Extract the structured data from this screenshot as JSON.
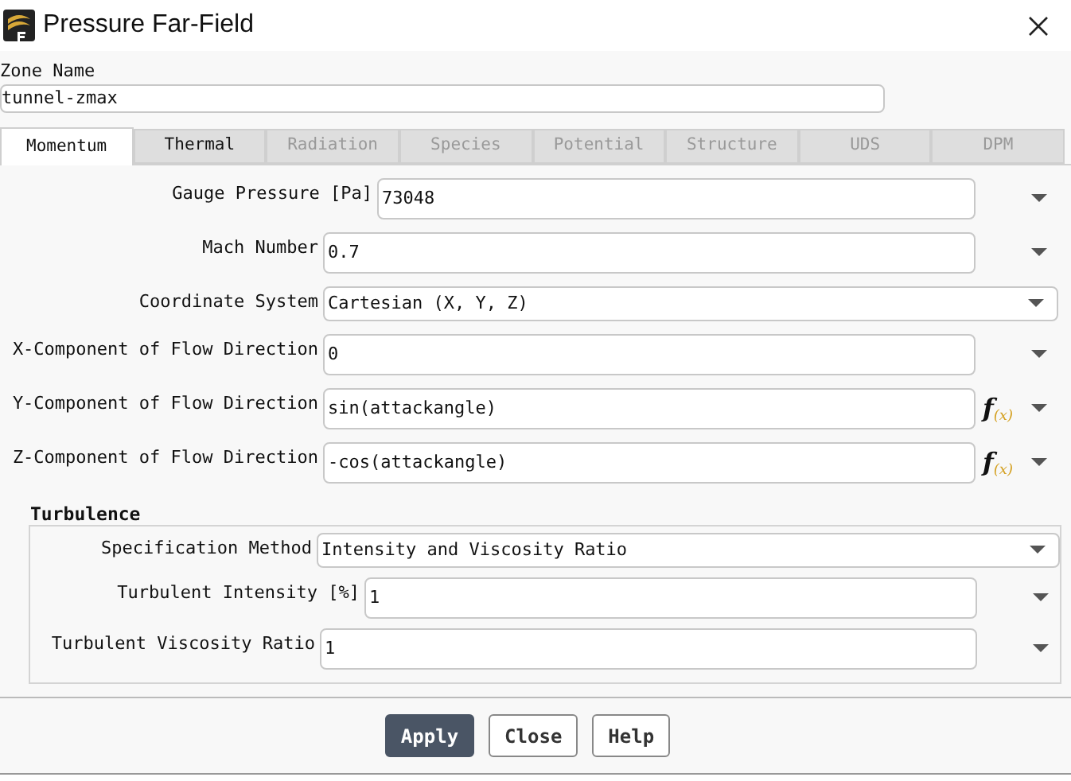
{
  "window": {
    "title": "Pressure Far-Field"
  },
  "zone": {
    "label": "Zone Name",
    "value": "tunnel-zmax"
  },
  "tabs": [
    {
      "label": "Momentum",
      "selected": true,
      "disabled": false
    },
    {
      "label": "Thermal",
      "selected": false,
      "disabled": false
    },
    {
      "label": "Radiation",
      "selected": false,
      "disabled": true
    },
    {
      "label": "Species",
      "selected": false,
      "disabled": true
    },
    {
      "label": "Potential",
      "selected": false,
      "disabled": true
    },
    {
      "label": "Structure",
      "selected": false,
      "disabled": true
    },
    {
      "label": "UDS",
      "selected": false,
      "disabled": true
    },
    {
      "label": "DPM",
      "selected": false,
      "disabled": true
    }
  ],
  "rows": [
    {
      "kind": "input",
      "label": "Gauge Pressure [Pa]",
      "value": "73048"
    },
    {
      "kind": "input",
      "label": "Mach Number",
      "value": "0.7"
    },
    {
      "kind": "dropdown",
      "label": "Coordinate System",
      "value": "Cartesian (X, Y, Z)"
    },
    {
      "kind": "input",
      "label": "X-Component of Flow Direction",
      "value": "0"
    },
    {
      "kind": "input",
      "label": "Y-Component of Flow Direction",
      "value": "sin(attackangle)",
      "function_button": "f$_{(x)}$"
    },
    {
      "kind": "input",
      "label": "Z-Component of Flow Direction",
      "value": "-cos(attackangle)",
      "function_button": "f$_{(x)}$"
    }
  ],
  "turbulence": {
    "title": "Turbulence",
    "rows": [
      {
        "kind": "dropdown",
        "label": "Specification Method",
        "value": "Intensity and Viscosity Ratio"
      },
      {
        "kind": "input",
        "label": "Turbulent Intensity [%]",
        "value": "1"
      },
      {
        "kind": "input",
        "label": "Turbulent Viscosity Ratio",
        "value": "1"
      }
    ]
  },
  "buttons": [
    {
      "label": "Apply",
      "primary": true
    },
    {
      "label": "Close",
      "primary": false
    },
    {
      "label": "Help",
      "primary": false
    }
  ]
}
